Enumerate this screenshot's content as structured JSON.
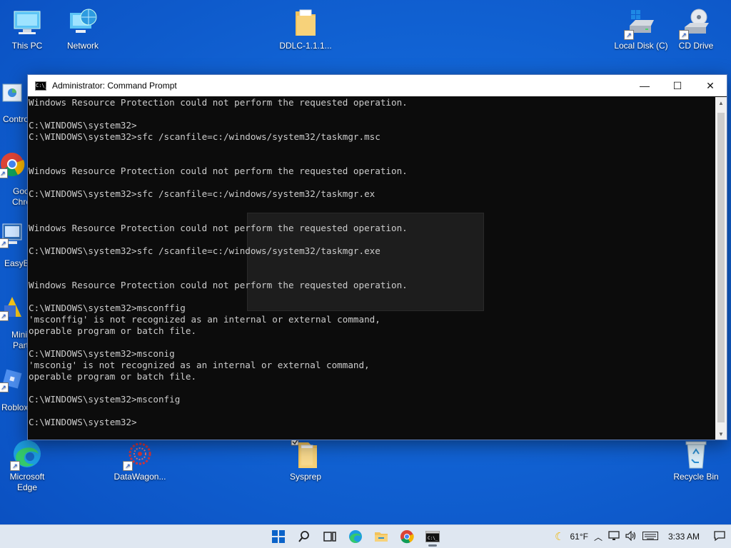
{
  "desktop": {
    "icons": [
      {
        "label": "This PC",
        "icon": "monitor-icon"
      },
      {
        "label": "Network",
        "icon": "network-icon"
      },
      {
        "label": "DDLC-1.1.1...",
        "icon": "folder-icon"
      },
      {
        "label": "Local Disk (C)",
        "icon": "drive-icon"
      },
      {
        "label": "CD Drive",
        "icon": "cd-drive-icon"
      },
      {
        "label": "Microsoft Edge",
        "icon": "edge-icon"
      },
      {
        "label": "DataWagon...",
        "icon": "datawagon-icon"
      },
      {
        "label": "Sysprep",
        "icon": "folder-icon"
      },
      {
        "label": "Recycle Bin",
        "icon": "recycle-bin-icon"
      }
    ],
    "partial_labels": [
      "Contro",
      "Goo",
      "Chro",
      "EasyB",
      "Mini",
      "Part",
      "Roblox"
    ]
  },
  "window": {
    "title": "Administrator: Command Prompt",
    "app_icon_text": "C:\\_",
    "controls": {
      "minimize": "—",
      "maximize": "☐",
      "close": "✕"
    },
    "console_lines": [
      "Windows Resource Protection could not perform the requested operation.",
      "",
      "C:\\WINDOWS\\system32>",
      "C:\\WINDOWS\\system32>sfc /scanfile=c:/windows/system32/taskmgr.msc",
      "",
      "",
      "Windows Resource Protection could not perform the requested operation.",
      "",
      "C:\\WINDOWS\\system32>sfc /scanfile=c:/windows/system32/taskmgr.ex",
      "",
      "",
      "Windows Resource Protection could not perform the requested operation.",
      "",
      "C:\\WINDOWS\\system32>sfc /scanfile=c:/windows/system32/taskmgr.exe",
      "",
      "",
      "Windows Resource Protection could not perform the requested operation.",
      "",
      "C:\\WINDOWS\\system32>msconffig",
      "'msconffig' is not recognized as an internal or external command,",
      "operable program or batch file.",
      "",
      "C:\\WINDOWS\\system32>msconig",
      "'msconig' is not recognized as an internal or external command,",
      "operable program or batch file.",
      "",
      "C:\\WINDOWS\\system32>msconfig",
      "",
      "C:\\WINDOWS\\system32>"
    ]
  },
  "taskbar": {
    "apps": [
      "start-icon",
      "search-icon",
      "task-view-icon",
      "edge-icon",
      "file-explorer-icon",
      "chrome-icon",
      "command-prompt-icon"
    ],
    "weather": "61°F",
    "time": "3:33 AM"
  },
  "colors": {
    "desktop": "#1265d6",
    "console_bg": "#0c0c0c",
    "console_text": "#cccccc",
    "taskbar": "#dfe7f1"
  }
}
